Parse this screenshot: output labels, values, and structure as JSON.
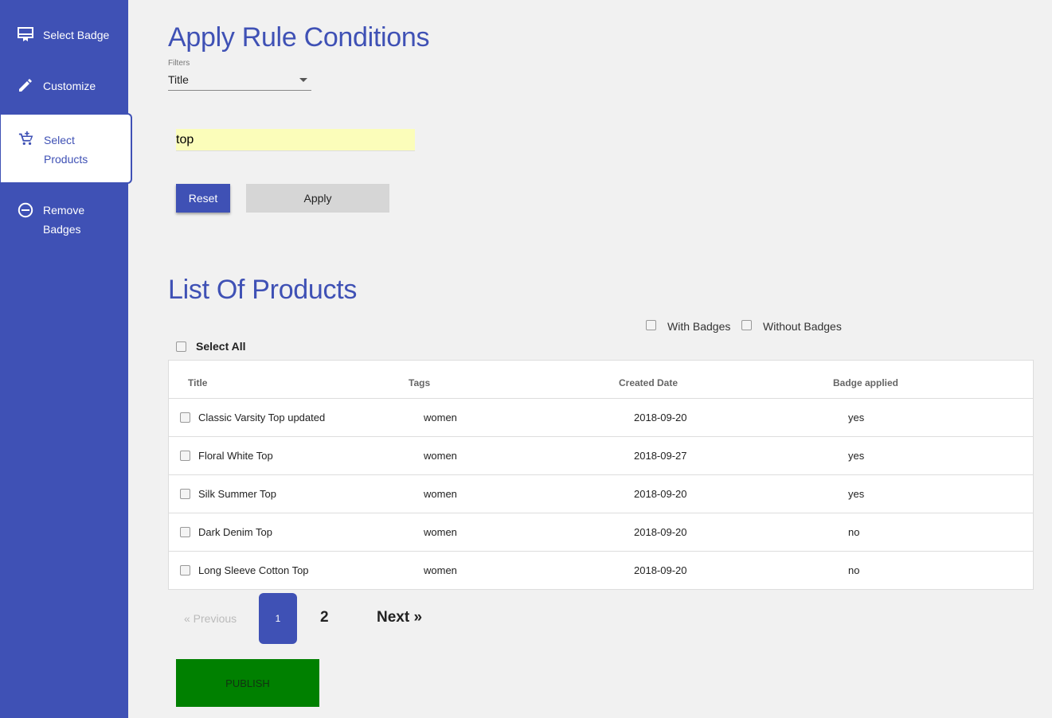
{
  "sidebar": {
    "items": [
      {
        "label": "Select Badge",
        "icon": "badge-card-icon"
      },
      {
        "label": "Customize",
        "icon": "pencil-icon"
      },
      {
        "label": "Select",
        "label2": "Products",
        "icon": "cart-plus-icon",
        "active": true
      },
      {
        "label": "Remove",
        "label2": "Badges",
        "icon": "minus-circle-icon"
      }
    ]
  },
  "rules": {
    "title": "Apply Rule Conditions",
    "filters_label": "Filters",
    "filter_value": "Title",
    "search_value": "top",
    "reset_label": "Reset",
    "apply_label": "Apply"
  },
  "products": {
    "title": "List Of Products",
    "with_badges_label": "With Badges",
    "without_badges_label": "Without Badges",
    "select_all_label": "Select All",
    "columns": [
      "Title",
      "Tags",
      "Created Date",
      "Badge applied"
    ],
    "rows": [
      {
        "title": "Classic Varsity Top updated",
        "tags": "women",
        "date": "2018-09-20",
        "badge": "yes"
      },
      {
        "title": "Floral White Top",
        "tags": "women",
        "date": "2018-09-27",
        "badge": "yes"
      },
      {
        "title": "Silk Summer Top",
        "tags": "women",
        "date": "2018-09-20",
        "badge": "yes"
      },
      {
        "title": "Dark Denim Top",
        "tags": "women",
        "date": "2018-09-20",
        "badge": "no"
      },
      {
        "title": "Long Sleeve Cotton Top",
        "tags": "women",
        "date": "2018-09-20",
        "badge": "no"
      }
    ]
  },
  "pagination": {
    "previous": "«  Previous",
    "page1": "1",
    "page2": "2",
    "next": "Next  »"
  },
  "publish_label": "PUBLISH",
  "colors": {
    "primary": "#3f51b5",
    "publish": "#008000",
    "input_bg": "#fbfdba"
  }
}
